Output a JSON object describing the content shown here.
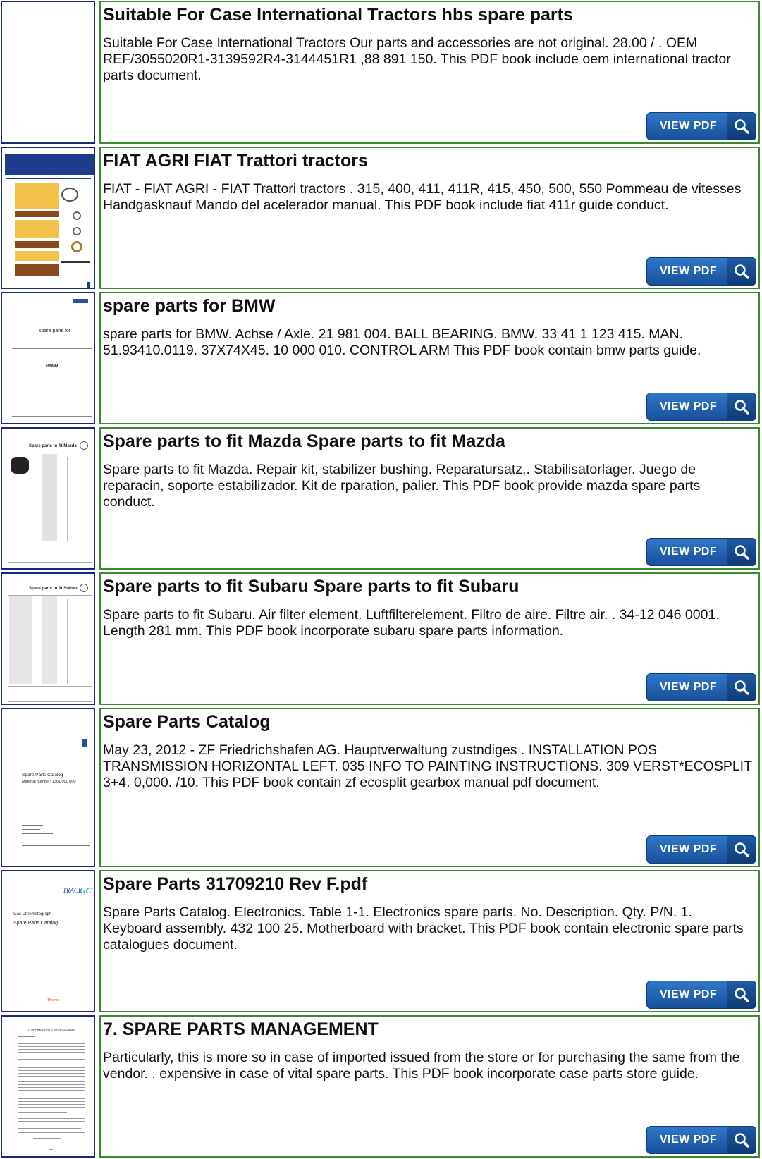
{
  "button_label": "VIEW PDF",
  "colors": {
    "thumb_border": "#1a2a7a",
    "card_border": "#3a8a2e",
    "button": "#2f78c8"
  },
  "items": [
    {
      "title": "Suitable For Case International Tractors hbs spare parts",
      "description": "Suitable For Case International Tractors Our parts and accessories are not original. 28.00 / . OEM REF/3055020R1-3139592R4-3144451R1 ,88 891 150. This PDF book include oem international tractor parts document.",
      "thumbnail": ""
    },
    {
      "title": "FIAT AGRI FIAT Trattori tractors",
      "description": "FIAT - FIAT AGRI - FIAT Trattori tractors . 315, 400, 411, 411R, 415, 450, 500, 550 Pommeau de vitesses Handgasknauf Mando del acelerador manual. This PDF book include fiat 411r guide conduct.",
      "thumbnail": "fiat"
    },
    {
      "title": "spare parts for BMW",
      "description": "spare parts for BMW. Achse / Axle. 21 981 004. BALL BEARING. BMW. 33 41 1 123 415. MAN. 51.93410.0119. 37X74X45. 10 000 010. CONTROL ARM This PDF book contain bmw parts guide.",
      "thumbnail": "bmw",
      "thumb_text": {
        "a": "spare parts for",
        "b": "BMW"
      }
    },
    {
      "title": "Spare parts to fit Mazda Spare parts to fit Mazda",
      "description": "Spare parts to fit Mazda. Repair kit, stabilizer bushing. Reparatursatz,. Stabilisatorlager. Juego de reparacin, soporte estabilizador. Kit de rparation, palier. This PDF book provide mazda spare parts conduct.",
      "thumbnail": "mazda",
      "thumb_text": {
        "a": "Spare parts to fit Mazda"
      }
    },
    {
      "title": "Spare parts to fit Subaru Spare parts to fit Subaru",
      "description": "Spare parts to fit Subaru. Air filter element. Luftfilterelement. Filtro de aire. Filtre air. . 34-12 046 0001. Length 281 mm. This PDF book incorporate subaru spare parts information.",
      "thumbnail": "subaru",
      "thumb_text": {
        "a": "Spare parts to fit Subaru"
      }
    },
    {
      "title": "Spare Parts Catalog",
      "description": "May 23, 2012 - ZF Friedrichshafen AG. Hauptverwaltung zustndiges . INSTALLATION POS TRANSMISSION HORIZONTAL LEFT. 035 INFO TO PAINTING INSTRUCTIONS. 309 VERST*ECOSPLIT 3+4. 0,000. /10. This PDF book contain zf ecosplit gearbox manual pdf document.",
      "thumbnail": "zf",
      "thumb_text": {
        "a": "Spare Parts Catalog",
        "b": "Material number: 1361 000 000"
      }
    },
    {
      "title": "Spare Parts 31709210 Rev F.pdf",
      "description": "Spare Parts Catalog. Electronics. Table 1-1. Electronics spare parts. No. Description. Qty. P/N. 1. Keyboard assembly. 432 100 25. Motherboard with bracket. This PDF book contain electronic spare parts catalogues document.",
      "thumbnail": "trace",
      "thumb_text": {
        "a": "TRACE",
        "b": "GC",
        "c": "Gas Chromatograph",
        "d": "Spare Parts Catalog",
        "e": "Thermo"
      }
    },
    {
      "title": "7. SPARE PARTS MANAGEMENT",
      "description": "Particularly, this is more so in case of imported issued from the store or for purchasing the same from the vendor. . expensive in case of vital spare parts. This PDF book incorporate case parts store guide.",
      "thumbnail": "text",
      "thumb_text": {
        "a": "7. SPARE PARTS MANAGEMENT"
      }
    }
  ]
}
